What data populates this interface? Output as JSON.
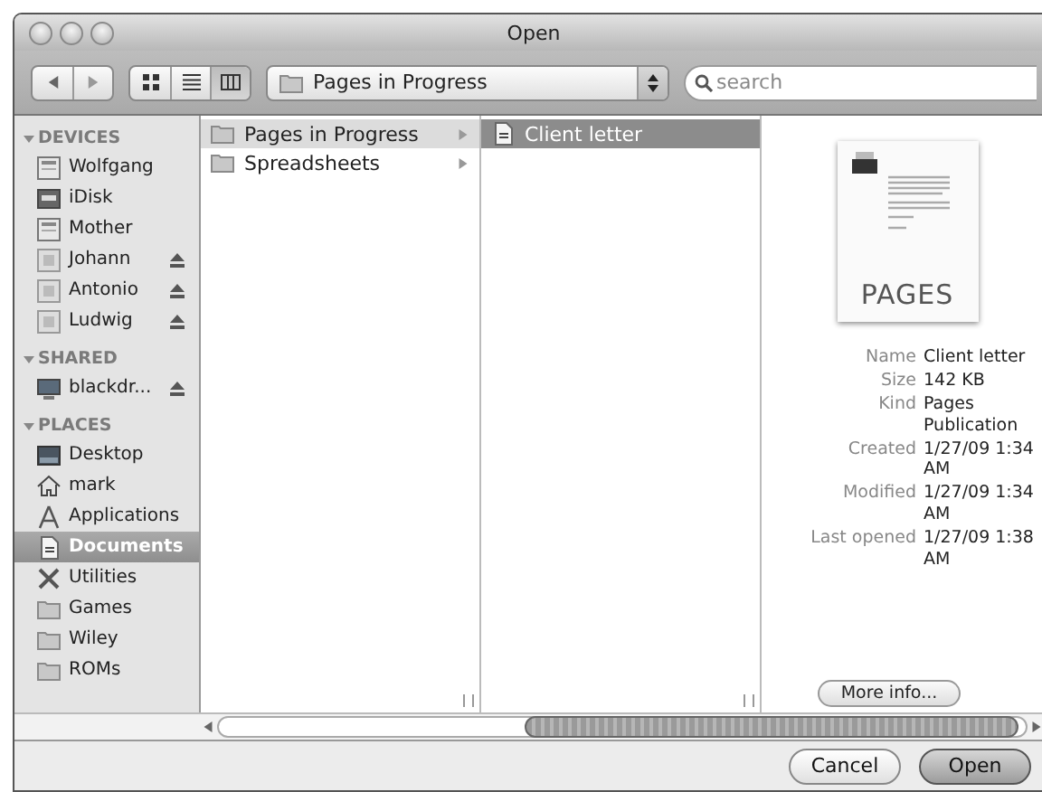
{
  "window": {
    "title": "Open"
  },
  "toolbar": {
    "view_modes": [
      {
        "kind": "icon",
        "selected": false
      },
      {
        "kind": "list",
        "selected": false
      },
      {
        "kind": "column",
        "selected": true
      }
    ],
    "path_popup": "Pages in Progress",
    "search": {
      "placeholder": "search"
    }
  },
  "sidebar": {
    "sections": [
      {
        "title": "DEVICES",
        "expanded": true,
        "items": [
          {
            "name": "Wolfgang",
            "kind": "computer",
            "eject": false,
            "selected": false
          },
          {
            "name": "iDisk",
            "kind": "idisk",
            "eject": false,
            "selected": false
          },
          {
            "name": "Mother",
            "kind": "computer",
            "eject": false,
            "selected": false
          },
          {
            "name": "Johann",
            "kind": "volume",
            "eject": true,
            "selected": false
          },
          {
            "name": "Antonio",
            "kind": "volume",
            "eject": true,
            "selected": false
          },
          {
            "name": "Ludwig",
            "kind": "volume",
            "eject": true,
            "selected": false
          }
        ]
      },
      {
        "title": "SHARED",
        "expanded": true,
        "items": [
          {
            "name": "blackdr...",
            "kind": "network",
            "eject": true,
            "selected": false
          }
        ]
      },
      {
        "title": "PLACES",
        "expanded": true,
        "items": [
          {
            "name": "Desktop",
            "kind": "desktop",
            "eject": false,
            "selected": false
          },
          {
            "name": "mark",
            "kind": "home",
            "eject": false,
            "selected": false
          },
          {
            "name": "Applications",
            "kind": "apps",
            "eject": false,
            "selected": false
          },
          {
            "name": "Documents",
            "kind": "document",
            "eject": false,
            "selected": true
          },
          {
            "name": "Utilities",
            "kind": "utilities",
            "eject": false,
            "selected": false
          },
          {
            "name": "Games",
            "kind": "folder",
            "eject": false,
            "selected": false
          },
          {
            "name": "Wiley",
            "kind": "folder",
            "eject": false,
            "selected": false
          },
          {
            "name": "ROMs",
            "kind": "folder",
            "eject": false,
            "selected": false
          }
        ]
      }
    ]
  },
  "columns": [
    {
      "focused": false,
      "items": [
        {
          "name": "Pages in Progress",
          "kind": "folder",
          "selected": true,
          "has_children": true
        },
        {
          "name": "Spreadsheets",
          "kind": "folder",
          "selected": false,
          "has_children": true
        }
      ]
    },
    {
      "focused": true,
      "items": [
        {
          "name": "Client letter",
          "kind": "document",
          "selected": true,
          "has_children": false
        }
      ]
    }
  ],
  "preview": {
    "thumbnail_label": "PAGES",
    "info": [
      {
        "label": "Name",
        "value": "Client letter"
      },
      {
        "label": "Size",
        "value": "142 KB"
      },
      {
        "label": "Kind",
        "value": "Pages Publication"
      },
      {
        "label": "Created",
        "value": "1/27/09 1:34 AM"
      },
      {
        "label": "Modified",
        "value": "1/27/09 1:34 AM"
      },
      {
        "label": "Last opened",
        "value": "1/27/09 1:38 AM"
      }
    ],
    "button": "More info..."
  },
  "buttons": [
    {
      "label": "Cancel",
      "default": false
    },
    {
      "label": "Open",
      "default": true
    }
  ]
}
